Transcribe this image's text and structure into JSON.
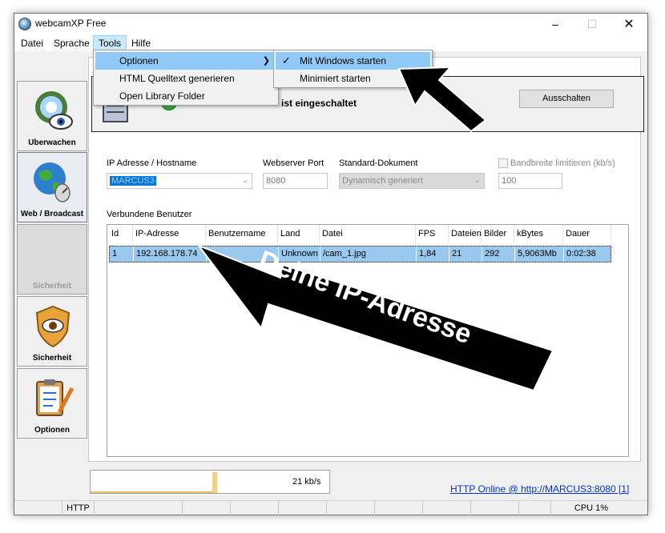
{
  "window": {
    "title": "webcamXP Free"
  },
  "menubar": {
    "items": [
      "Datei",
      "Sprache",
      "Tools",
      "Hilfe"
    ]
  },
  "tools_menu": {
    "items": [
      "Optionen",
      "HTML Quelltext generieren",
      "Open Library Folder"
    ]
  },
  "optionen_submenu": {
    "items": [
      "Mit Windows starten",
      "Minimiert starten"
    ]
  },
  "sidebar": {
    "items": [
      "Überwachen",
      "Web / Broadcast",
      "Sicherheit",
      "Sicherheit",
      "Optionen"
    ]
  },
  "status": {
    "text": "ist eingeschaltet",
    "button": "Ausschalten"
  },
  "form": {
    "ip_label": "IP Adresse / Hostname",
    "ip_value": "MARCUS3",
    "port_label": "Webserver Port",
    "port_value": "8080",
    "doc_label": "Standard-Dokument",
    "doc_value": "Dynamisch generiert",
    "bw_label": "Bandbreite limitieren (kb/s)",
    "bw_value": "100"
  },
  "users": {
    "title": "Verbundene Benutzer",
    "columns": [
      "Id",
      "IP-Adresse",
      "Benutzername",
      "Land",
      "Datei",
      "FPS",
      "Dateien",
      "Bilder",
      "kBytes",
      "Dauer"
    ],
    "rows": [
      [
        "1",
        "192.168.178.74",
        "",
        "Unknown",
        "/cam_1.jpg",
        "1,84",
        "21",
        "292",
        "5,9063Mb",
        "0:02:38"
      ]
    ]
  },
  "bandwidth": {
    "rate": "21 kb/s"
  },
  "http_status": "HTTP Online @ http://MARCUS3:8080 [1]",
  "statusbar": {
    "protocol": "HTTP",
    "cpu": "CPU 1%"
  },
  "annotation": {
    "text": "Deine IP-Adresse"
  },
  "colors": {
    "accent": "#0078d7",
    "row_selected": "#99c9ef",
    "menu_highlight": "#91c9f7",
    "link": "#0033cc"
  }
}
